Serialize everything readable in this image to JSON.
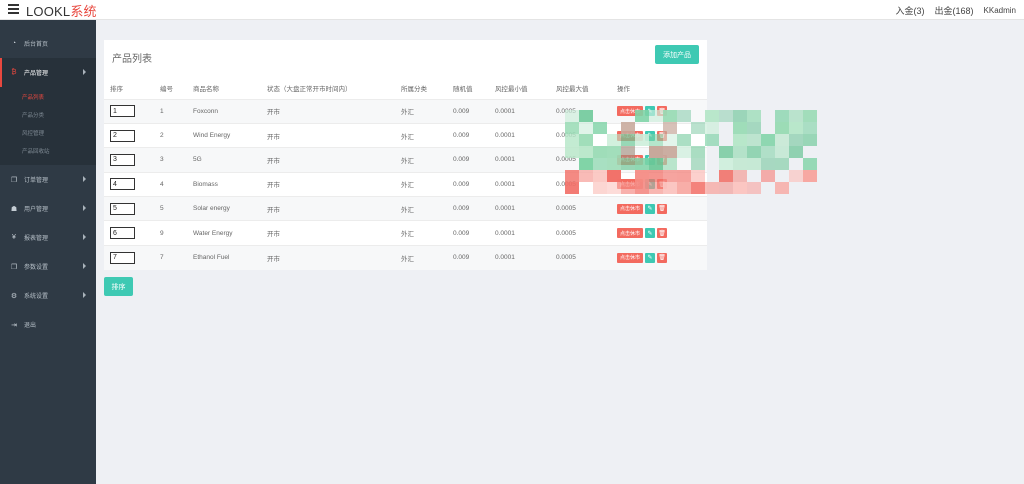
{
  "app": {
    "logo_main": "LOOKL",
    "logo_accent": "系统",
    "deposit": "入金(3)",
    "withdraw": "出金(168)",
    "user": "KKadmin"
  },
  "sidebar": {
    "items": [
      {
        "label": "后台首页",
        "icon": "dashboard-icon"
      },
      {
        "label": "产品管理",
        "icon": "bitcoin-icon"
      },
      {
        "label": "订单管理",
        "icon": "copy-icon"
      },
      {
        "label": "用户管理",
        "icon": "user-icon"
      },
      {
        "label": "报表管理",
        "icon": "yen-icon"
      },
      {
        "label": "参数设置",
        "icon": "copy-icon"
      },
      {
        "label": "系统设置",
        "icon": "gears-icon"
      },
      {
        "label": "退出",
        "icon": "sign-out-icon"
      }
    ],
    "sub_items": [
      "产品列表",
      "产品分类",
      "风控管理",
      "产品回收站"
    ]
  },
  "panel": {
    "title": "产品列表",
    "add_button": "添加产品",
    "sort_button": "排序"
  },
  "table": {
    "headers": [
      "排序",
      "编号",
      "商品名称",
      "状态（大盘正常开市时间内）",
      "所属分类",
      "随机值",
      "风控最小值",
      "风控最大值",
      "操作"
    ],
    "rows": [
      {
        "sort": "1",
        "id": "1",
        "name": "Foxconn",
        "status": "开市",
        "category": "外汇",
        "random": "0.009",
        "min": "0.0001",
        "max": "0.0005"
      },
      {
        "sort": "2",
        "id": "2",
        "name": "Wind Energy",
        "status": "开市",
        "category": "外汇",
        "random": "0.009",
        "min": "0.0001",
        "max": "0.0005"
      },
      {
        "sort": "3",
        "id": "3",
        "name": "5G",
        "status": "开市",
        "category": "外汇",
        "random": "0.009",
        "min": "0.0001",
        "max": "0.0005"
      },
      {
        "sort": "4",
        "id": "4",
        "name": "Biomass",
        "status": "开市",
        "category": "外汇",
        "random": "0.009",
        "min": "0.0001",
        "max": "0.0005"
      },
      {
        "sort": "5",
        "id": "5",
        "name": "Solar energy",
        "status": "开市",
        "category": "外汇",
        "random": "0.009",
        "min": "0.0001",
        "max": "0.0005"
      },
      {
        "sort": "6",
        "id": "9",
        "name": "Water Energy",
        "status": "开市",
        "category": "外汇",
        "random": "0.009",
        "min": "0.0001",
        "max": "0.0005"
      },
      {
        "sort": "7",
        "id": "7",
        "name": "Ethanol Fuel",
        "status": "开市",
        "category": "外汇",
        "random": "0.009",
        "min": "0.0001",
        "max": "0.0005"
      }
    ],
    "rest_label": "点击休市"
  },
  "colors": {
    "accent": "#3ec9b3",
    "danger": "#f36a5f",
    "sidebar": "#2f3a45",
    "brand_red": "#e8483f"
  }
}
